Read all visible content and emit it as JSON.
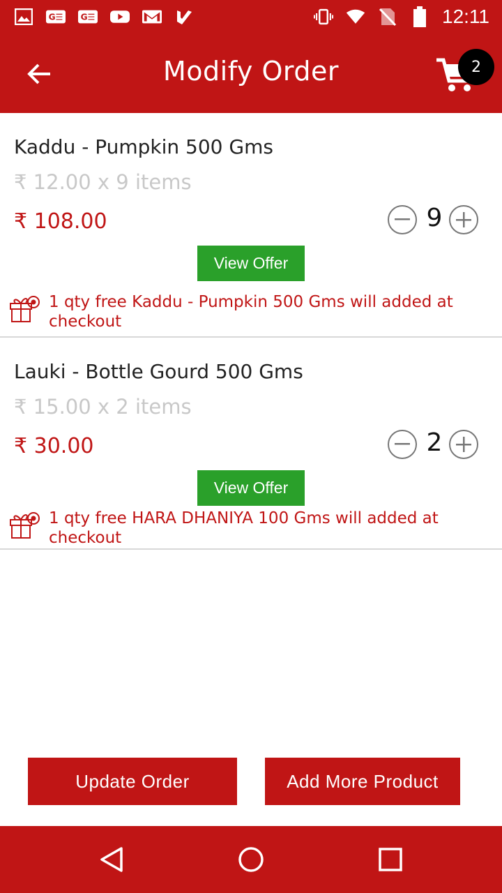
{
  "status_bar": {
    "time": "12:11",
    "left_icons": [
      "image-icon",
      "ge-icon",
      "ge-icon",
      "youtube-icon",
      "gmail-icon",
      "check-icon"
    ],
    "right_icons": [
      "vibrate-icon",
      "wifi-icon",
      "no-sim-icon",
      "battery-icon"
    ]
  },
  "header": {
    "title": "Modify Order",
    "back_icon": "arrow-left-icon",
    "cart_icon": "cart-icon",
    "cart_count": "2"
  },
  "items": [
    {
      "name": "Kaddu - Pumpkin 500 Gms",
      "unit_line": "₹ 12.00 x 9 items",
      "total": "₹ 108.00",
      "qty": "9",
      "offer_button": "View Offer",
      "offer_text": "1 qty free Kaddu - Pumpkin 500 Gms will added at checkout"
    },
    {
      "name": "Lauki - Bottle Gourd 500 Gms",
      "unit_line": "₹ 15.00 x 2 items",
      "total": "₹ 30.00",
      "qty": "2",
      "offer_button": "View Offer",
      "offer_text": "1 qty free HARA DHANIYA 100 Gms will added at checkout"
    }
  ],
  "actions": {
    "update_label": "Update Order",
    "add_more_label": "Add More Product"
  },
  "colors": {
    "brand_red": "#c01515",
    "offer_green": "#2aa02a",
    "muted_text": "#c8c8c8"
  }
}
